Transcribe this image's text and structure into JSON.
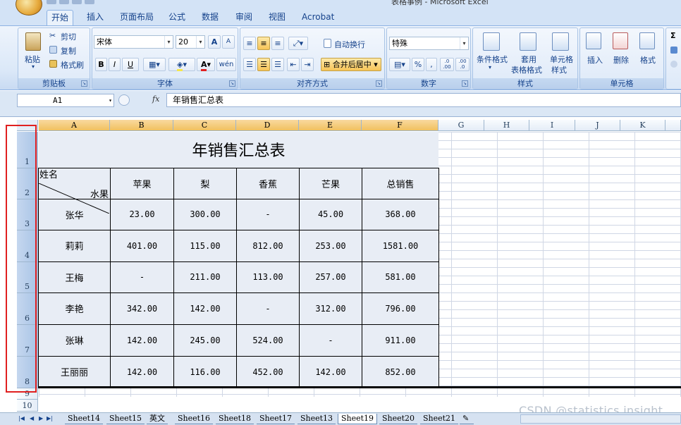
{
  "window": {
    "title": "表格事例 - Microsoft Excel"
  },
  "tabs": [
    "开始",
    "插入",
    "页面布局",
    "公式",
    "数据",
    "审阅",
    "视图",
    "Acrobat"
  ],
  "ribbon": {
    "clipboard": {
      "paste": "粘贴",
      "cut": "剪切",
      "copy": "复制",
      "format_painter": "格式刷",
      "label": "剪贴板"
    },
    "font": {
      "name": "宋体",
      "size": "20",
      "bold": "B",
      "italic": "I",
      "underline": "U",
      "grow": "A",
      "shrink": "A",
      "font_color": "A",
      "phonetic": "wén",
      "label": "字体"
    },
    "alignment": {
      "wrap": "自动换行",
      "merge": "合并后居中",
      "label": "对齐方式"
    },
    "number": {
      "format": "特殊",
      "percent": "%",
      "comma": ",",
      "inc_decimal": ".0 .00",
      "dec_decimal": ".00 .0",
      "label": "数字"
    },
    "styles": {
      "conditional": "条件格式",
      "table_format_1": "套用",
      "table_format_2": "表格格式",
      "cell_styles_1": "单元格",
      "cell_styles_2": "样式",
      "label": "样式"
    },
    "cells": {
      "insert": "插入",
      "delete": "删除",
      "format": "格式",
      "label": "单元格"
    },
    "editing": {
      "sigma": "Σ"
    }
  },
  "formula_bar": {
    "cell_ref": "A1",
    "fx": "fx",
    "content": "年销售汇总表"
  },
  "columns": [
    "A",
    "B",
    "C",
    "D",
    "E",
    "F",
    "G",
    "H",
    "I",
    "J",
    "K"
  ],
  "rows": [
    "1",
    "2",
    "3",
    "4",
    "5",
    "6",
    "7",
    "8",
    "9",
    "10"
  ],
  "sheet": {
    "title": "年销售汇总表",
    "diag_top": "水果",
    "diag_bottom": "姓名",
    "headers": [
      "苹果",
      "梨",
      "香蕉",
      "芒果",
      "总销售"
    ],
    "data": [
      {
        "name": "张华",
        "values": [
          "23.00",
          "300.00",
          "-",
          "45.00",
          "368.00"
        ]
      },
      {
        "name": "莉莉",
        "values": [
          "401.00",
          "115.00",
          "812.00",
          "253.00",
          "1581.00"
        ]
      },
      {
        "name": "王梅",
        "values": [
          "-",
          "211.00",
          "113.00",
          "257.00",
          "581.00"
        ]
      },
      {
        "name": "李艳",
        "values": [
          "342.00",
          "142.00",
          "-",
          "312.00",
          "796.00"
        ]
      },
      {
        "name": "张琳",
        "values": [
          "142.00",
          "245.00",
          "524.00",
          "-",
          "911.00"
        ]
      },
      {
        "name": "王丽丽",
        "values": [
          "142.00",
          "116.00",
          "452.00",
          "142.00",
          "852.00"
        ]
      }
    ]
  },
  "sheet_tabs": [
    "Sheet14",
    "Sheet15",
    "英文",
    "Sheet16",
    "Sheet18",
    "Sheet17",
    "Sheet13",
    "Sheet19",
    "Sheet20",
    "Sheet21"
  ],
  "active_sheet": "Sheet19",
  "watermark": "CSDN @statistics.insight",
  "colors": {
    "accent": "#15428b",
    "highlight_box": "#e02020",
    "ribbon_bg": "#dbe8f8"
  }
}
